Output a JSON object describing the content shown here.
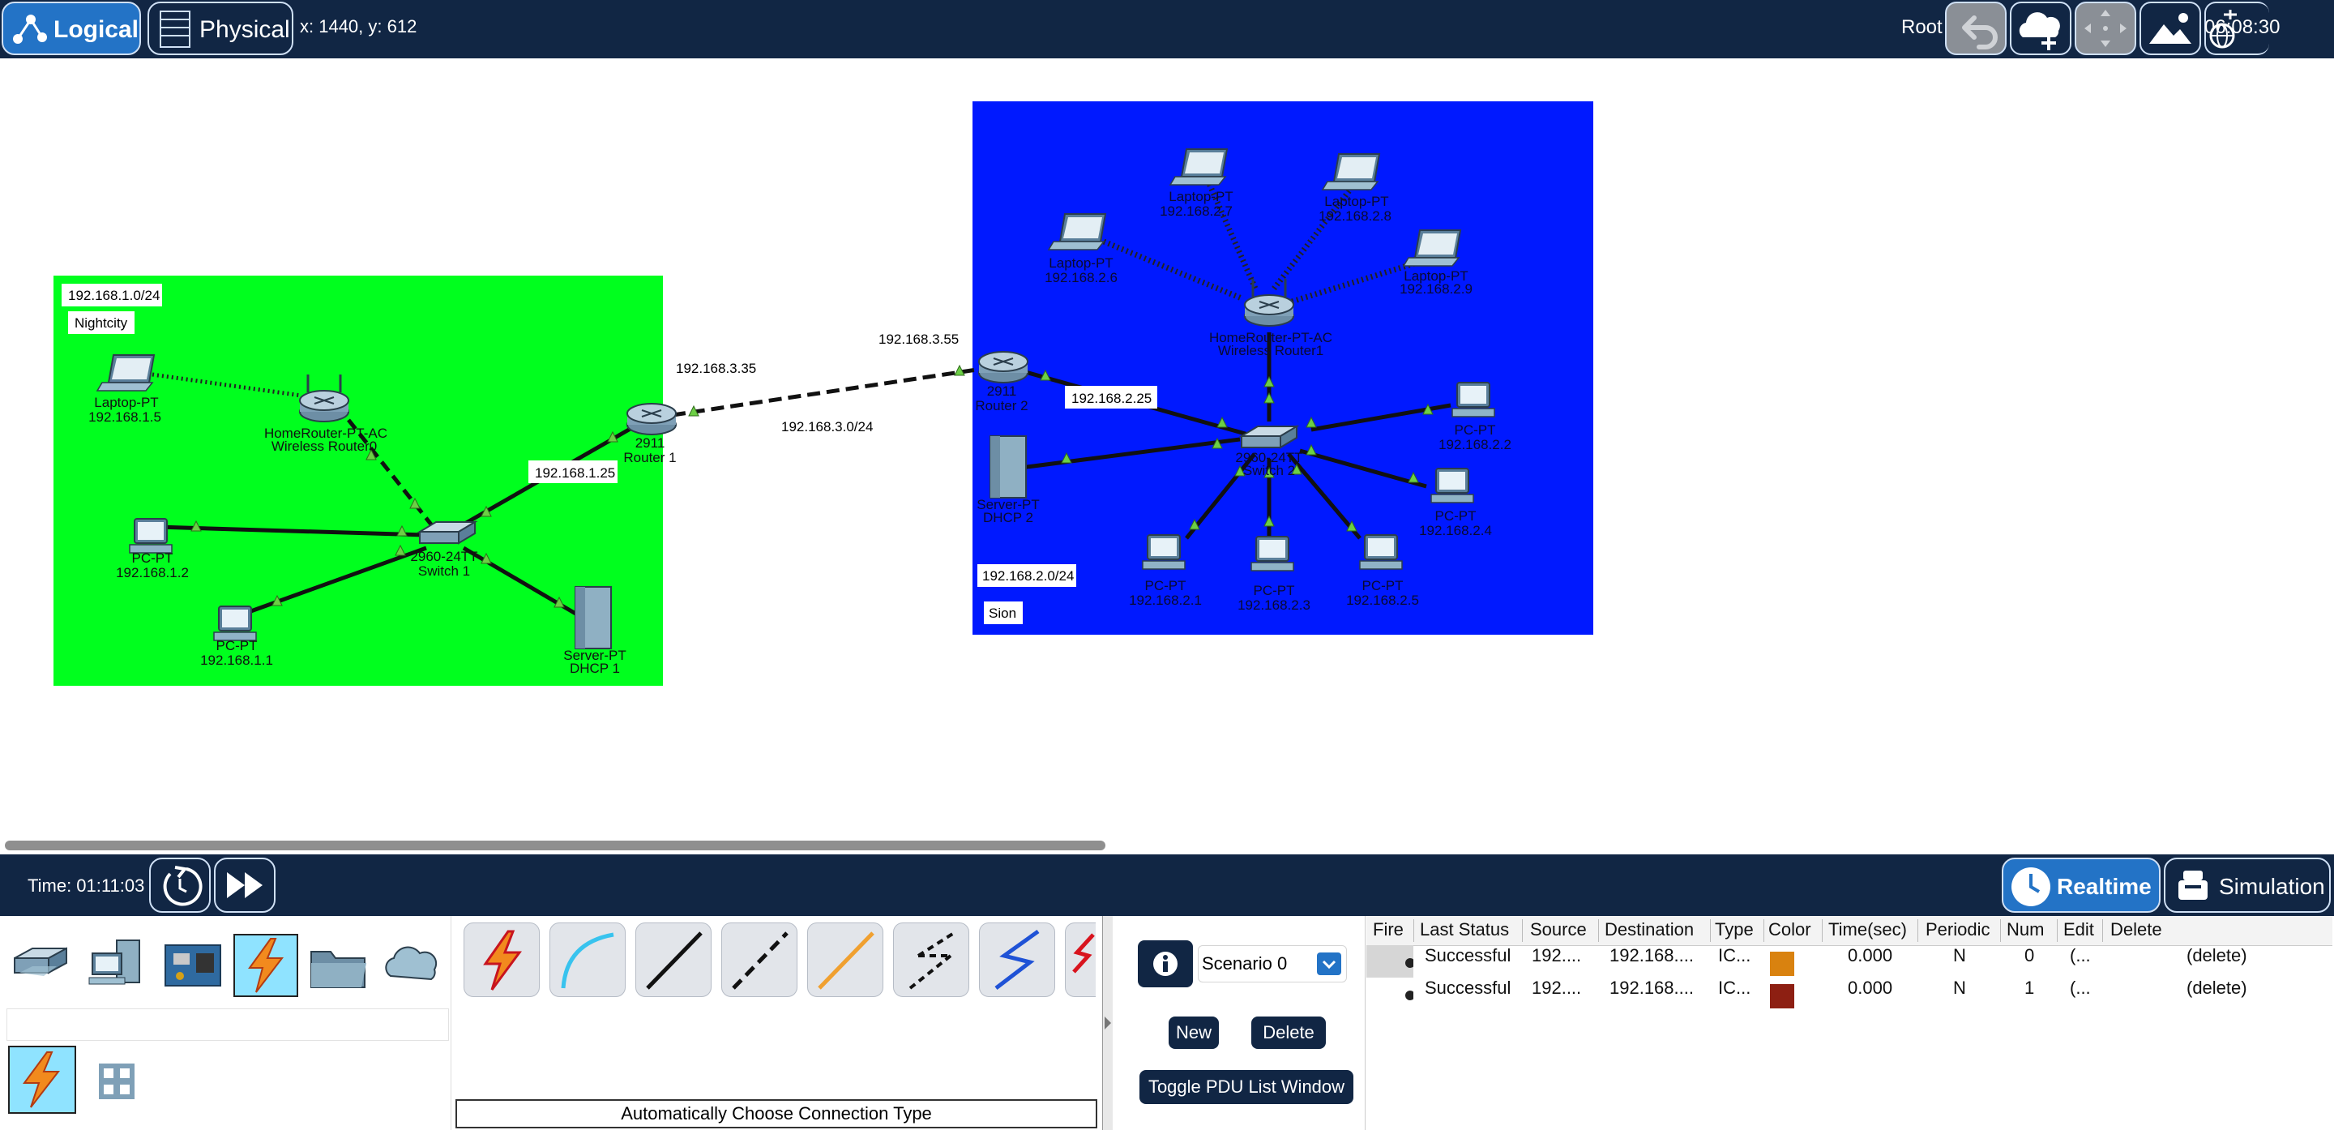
{
  "toolbar": {
    "logical_label": "Logical",
    "physical_label": "Physical",
    "coordinates": "x: 1440, y: 612",
    "root_label": "Root",
    "clock": "06:08:30"
  },
  "network": {
    "areas": [
      {
        "subnet": "192.168.1.0/24",
        "name": "Nightcity",
        "color": "#00ff1e"
      },
      {
        "subnet": "192.168.2.0/24",
        "name": "Sion",
        "color": "#0019ff"
      }
    ],
    "link_labels": {
      "wan_left": "192.168.3.35",
      "wan_right": "192.168.3.55",
      "wan_subnet": "192.168.3.0/24",
      "router1_lan": "192.168.1.25",
      "router2_lan": "192.168.2.25"
    },
    "devices": {
      "laptop_15": {
        "model": "Laptop-PT",
        "ip": "192.168.1.5"
      },
      "wr0": {
        "model": "HomeRouter-PT-AC",
        "name": "Wireless Router0"
      },
      "router1": {
        "model": "2911",
        "name": "Router 1"
      },
      "pc_12": {
        "model": "PC-PT",
        "ip": "192.168.1.2"
      },
      "switch1": {
        "model": "2960-24TT",
        "name": "Switch 1"
      },
      "pc_11": {
        "model": "PC-PT",
        "ip": "192.168.1.1"
      },
      "server1": {
        "model": "Server-PT",
        "name": "DHCP 1"
      },
      "laptop_27": {
        "model": "Laptop-PT",
        "ip": "192.168.2.7"
      },
      "laptop_28": {
        "model": "Laptop-PT",
        "ip": "192.168.2.8"
      },
      "laptop_26": {
        "model": "Laptop-PT",
        "ip": "192.168.2.6"
      },
      "laptop_29": {
        "model": "Laptop-PT",
        "ip": "192.168.2.9"
      },
      "wr1": {
        "model": "HomeRouter-PT-AC",
        "name": "Wireless Router1"
      },
      "router2": {
        "model": "2911",
        "name": "Router 2"
      },
      "switch2": {
        "model": "2960-24TT",
        "name": "Switch 2"
      },
      "server2": {
        "model": "Server-PT",
        "name": "DHCP 2"
      },
      "pc_22": {
        "model": "PC-PT",
        "ip": "192.168.2.2"
      },
      "pc_24": {
        "model": "PC-PT",
        "ip": "192.168.2.4"
      },
      "pc_21": {
        "model": "PC-PT",
        "ip": "192.168.2.1"
      },
      "pc_23": {
        "model": "PC-PT",
        "ip": "192.168.2.3"
      },
      "pc_25": {
        "model": "PC-PT",
        "ip": "192.168.2.5"
      }
    }
  },
  "bottombar": {
    "time": "Time: 01:11:03",
    "realtime_label": "Realtime",
    "simulation_label": "Simulation"
  },
  "device_panel": {
    "categories": [
      "network-devices-icon",
      "end-devices-icon",
      "components-icon",
      "connections-icon",
      "miscellaneous-icon",
      "multiuser-cloud-icon"
    ],
    "connection_types": [
      "automatic-connection-icon",
      "console-cable-icon",
      "copper-straight-through-icon",
      "copper-cross-over-icon",
      "fiber-icon",
      "phone-cable-icon",
      "serial-dce-icon",
      "serial-dte-icon"
    ],
    "status": "Automatically Choose Connection Type"
  },
  "scenario": {
    "selected": "Scenario 0",
    "new_label": "New",
    "delete_label": "Delete",
    "toggle_label": "Toggle PDU List Window"
  },
  "pdu_table": {
    "headers": [
      "Fire",
      "Last Status",
      "Source",
      "Destination",
      "Type",
      "Color",
      "Time(sec)",
      "Periodic",
      "Num",
      "Edit",
      "Delete"
    ],
    "rows": [
      {
        "status": "Successful",
        "source": "192....",
        "destination": "192.168....",
        "type": "IC...",
        "color": "#d9820f",
        "time": "0.000",
        "periodic": "N",
        "num": "0",
        "edit": "(...",
        "delete": "(delete)"
      },
      {
        "status": "Successful",
        "source": "192....",
        "destination": "192.168....",
        "type": "IC...",
        "color": "#8d1f12",
        "time": "0.000",
        "periodic": "N",
        "num": "1",
        "edit": "(...",
        "delete": "(delete)"
      }
    ]
  }
}
